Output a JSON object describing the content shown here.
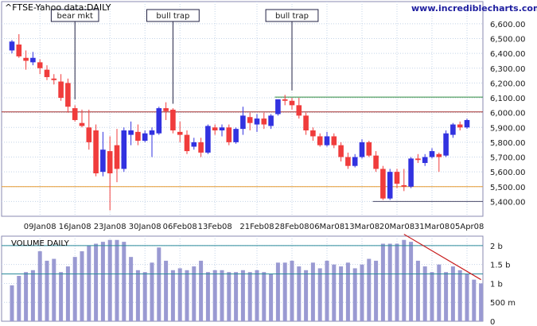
{
  "colors": {
    "up": "#3232e0",
    "down": "#f03c3c",
    "volume": "#9a9ad2",
    "grid": "#c4d4e8",
    "frame": "#8a8ab0",
    "resistance": "#2e8b3e",
    "support_red": "#a02828",
    "support_orange": "#e69a32",
    "support_dark": "#4a4a6a",
    "trend": "#c81e1e",
    "vol_line": "#2a8a9a",
    "text": "#1a1a1a"
  },
  "chart_data": [
    {
      "type": "candlestick",
      "title": "^FTSE-Yahoo data:DAILY",
      "site": "www.incrediblecharts.com",
      "ylim": [
        5300,
        6750
      ],
      "yticks": [
        5400,
        5500,
        5600,
        5700,
        5800,
        5900,
        6000,
        6100,
        6200,
        6300,
        6400,
        6500,
        6600
      ],
      "ytick_labels": [
        "5,400.00",
        "5,500.00",
        "5,600.00",
        "5,700.00",
        "5,800.00",
        "5,900.00",
        "6,000.00",
        "6,100.00",
        "6,200.00",
        "6,300.00",
        "6,400.00",
        "6,500.00",
        "6,600.00"
      ],
      "xtick_labels": [
        {
          "label": "09Jan08",
          "index": 4
        },
        {
          "label": "16Jan08",
          "index": 9
        },
        {
          "label": "23Jan08",
          "index": 14
        },
        {
          "label": "30Jan08",
          "index": 19
        },
        {
          "label": "06Feb08",
          "index": 24
        },
        {
          "label": "13Feb08",
          "index": 29
        },
        {
          "label": "21Feb08",
          "index": 35
        },
        {
          "label": "28Feb08",
          "index": 40
        },
        {
          "label": "06Mar08",
          "index": 45
        },
        {
          "label": "13Mar08",
          "index": 50
        },
        {
          "label": "20Mar08",
          "index": 55
        },
        {
          "label": "31Mar08",
          "index": 60
        },
        {
          "label": "05Apr08",
          "index": 65
        }
      ],
      "candles": [
        {
          "o": 6420,
          "h": 6490,
          "l": 6400,
          "c": 6480
        },
        {
          "o": 6460,
          "h": 6530,
          "l": 6370,
          "c": 6380
        },
        {
          "o": 6370,
          "h": 6420,
          "l": 6290,
          "c": 6350
        },
        {
          "o": 6340,
          "h": 6410,
          "l": 6320,
          "c": 6370
        },
        {
          "o": 6340,
          "h": 6360,
          "l": 6260,
          "c": 6300
        },
        {
          "o": 6290,
          "h": 6320,
          "l": 6220,
          "c": 6240
        },
        {
          "o": 6230,
          "h": 6260,
          "l": 6190,
          "c": 6220
        },
        {
          "o": 6210,
          "h": 6260,
          "l": 6080,
          "c": 6100
        },
        {
          "o": 6200,
          "h": 6230,
          "l": 6000,
          "c": 6040
        },
        {
          "o": 6030,
          "h": 6050,
          "l": 5940,
          "c": 5950
        },
        {
          "o": 5930,
          "h": 6020,
          "l": 5900,
          "c": 5910
        },
        {
          "o": 5900,
          "h": 6020,
          "l": 5750,
          "c": 5800
        },
        {
          "o": 5880,
          "h": 5920,
          "l": 5570,
          "c": 5590
        },
        {
          "o": 5600,
          "h": 5870,
          "l": 5570,
          "c": 5750
        },
        {
          "o": 5740,
          "h": 5840,
          "l": 5340,
          "c": 5590
        },
        {
          "o": 5780,
          "h": 5890,
          "l": 5530,
          "c": 5620
        },
        {
          "o": 5620,
          "h": 5900,
          "l": 5600,
          "c": 5880
        },
        {
          "o": 5850,
          "h": 5940,
          "l": 5780,
          "c": 5880
        },
        {
          "o": 5870,
          "h": 5920,
          "l": 5780,
          "c": 5810
        },
        {
          "o": 5810,
          "h": 5880,
          "l": 5800,
          "c": 5860
        },
        {
          "o": 5850,
          "h": 5900,
          "l": 5700,
          "c": 5880
        },
        {
          "o": 5860,
          "h": 6040,
          "l": 5850,
          "c": 6030
        },
        {
          "o": 6030,
          "h": 6070,
          "l": 5950,
          "c": 6010
        },
        {
          "o": 6020,
          "h": 6030,
          "l": 5860,
          "c": 5880
        },
        {
          "o": 5870,
          "h": 5940,
          "l": 5800,
          "c": 5850
        },
        {
          "o": 5850,
          "h": 5880,
          "l": 5720,
          "c": 5740
        },
        {
          "o": 5770,
          "h": 5830,
          "l": 5750,
          "c": 5800
        },
        {
          "o": 5800,
          "h": 5830,
          "l": 5700,
          "c": 5730
        },
        {
          "o": 5730,
          "h": 5920,
          "l": 5720,
          "c": 5910
        },
        {
          "o": 5900,
          "h": 5920,
          "l": 5850,
          "c": 5880
        },
        {
          "o": 5880,
          "h": 5920,
          "l": 5840,
          "c": 5900
        },
        {
          "o": 5900,
          "h": 5920,
          "l": 5780,
          "c": 5800
        },
        {
          "o": 5800,
          "h": 5900,
          "l": 5790,
          "c": 5890
        },
        {
          "o": 5890,
          "h": 6040,
          "l": 5850,
          "c": 5980
        },
        {
          "o": 5970,
          "h": 6000,
          "l": 5880,
          "c": 5930
        },
        {
          "o": 5920,
          "h": 5990,
          "l": 5870,
          "c": 5960
        },
        {
          "o": 5960,
          "h": 6000,
          "l": 5890,
          "c": 5920
        },
        {
          "o": 5910,
          "h": 5990,
          "l": 5890,
          "c": 5980
        },
        {
          "o": 5990,
          "h": 6060,
          "l": 5980,
          "c": 6090
        },
        {
          "o": 6090,
          "h": 6120,
          "l": 6050,
          "c": 6080
        },
        {
          "o": 6080,
          "h": 6100,
          "l": 6020,
          "c": 6050
        },
        {
          "o": 6050,
          "h": 6100,
          "l": 5960,
          "c": 5980
        },
        {
          "o": 5980,
          "h": 6000,
          "l": 5850,
          "c": 5880
        },
        {
          "o": 5880,
          "h": 5900,
          "l": 5810,
          "c": 5840
        },
        {
          "o": 5840,
          "h": 5860,
          "l": 5770,
          "c": 5780
        },
        {
          "o": 5780,
          "h": 5870,
          "l": 5770,
          "c": 5840
        },
        {
          "o": 5840,
          "h": 5860,
          "l": 5760,
          "c": 5780
        },
        {
          "o": 5780,
          "h": 5800,
          "l": 5670,
          "c": 5700
        },
        {
          "o": 5700,
          "h": 5730,
          "l": 5620,
          "c": 5640
        },
        {
          "o": 5640,
          "h": 5720,
          "l": 5630,
          "c": 5700
        },
        {
          "o": 5700,
          "h": 5820,
          "l": 5690,
          "c": 5800
        },
        {
          "o": 5800,
          "h": 5810,
          "l": 5700,
          "c": 5710
        },
        {
          "o": 5710,
          "h": 5740,
          "l": 5600,
          "c": 5620
        },
        {
          "o": 5620,
          "h": 5640,
          "l": 5410,
          "c": 5420
        },
        {
          "o": 5420,
          "h": 5620,
          "l": 5410,
          "c": 5600
        },
        {
          "o": 5600,
          "h": 5620,
          "l": 5490,
          "c": 5520
        },
        {
          "o": 5510,
          "h": 5620,
          "l": 5470,
          "c": 5500
        },
        {
          "o": 5500,
          "h": 5700,
          "l": 5490,
          "c": 5690
        },
        {
          "o": 5690,
          "h": 5720,
          "l": 5660,
          "c": 5680
        },
        {
          "o": 5660,
          "h": 5720,
          "l": 5640,
          "c": 5700
        },
        {
          "o": 5700,
          "h": 5760,
          "l": 5690,
          "c": 5740
        },
        {
          "o": 5720,
          "h": 5730,
          "l": 5600,
          "c": 5700
        },
        {
          "o": 5710,
          "h": 5880,
          "l": 5700,
          "c": 5860
        },
        {
          "o": 5850,
          "h": 5930,
          "l": 5830,
          "c": 5920
        },
        {
          "o": 5920,
          "h": 5940,
          "l": 5880,
          "c": 5900
        },
        {
          "o": 5900,
          "h": 5960,
          "l": 5890,
          "c": 5950
        }
      ],
      "levels": [
        {
          "value": 6105,
          "role": "resistance",
          "from_index": 38,
          "to_index": 68
        },
        {
          "value": 6005,
          "role": "support_red",
          "from_index": -1,
          "to_index": 68
        },
        {
          "value": 5500,
          "role": "support_orange",
          "from_index": -1,
          "to_index": 68
        },
        {
          "value": 5400,
          "role": "support_dark",
          "from_index": 52,
          "to_index": 68
        }
      ],
      "annotations": [
        {
          "label": "bear mkt",
          "index": 9,
          "value": 6090
        },
        {
          "label": "bull trap",
          "index": 23,
          "value": 6060
        },
        {
          "label": "bull trap",
          "index": 40,
          "value": 6150
        }
      ]
    },
    {
      "type": "bar",
      "title": "VOLUME DAILY",
      "ylim": [
        0,
        2.25
      ],
      "yticks": [
        0,
        0.5,
        1,
        1.5,
        2
      ],
      "ytick_labels": [
        "0",
        "500 m",
        "1 b",
        "1.5 b",
        "2 b"
      ],
      "values": [
        0.95,
        1.2,
        1.3,
        1.35,
        1.85,
        1.6,
        1.65,
        1.3,
        1.45,
        1.7,
        1.85,
        2.0,
        2.05,
        2.1,
        2.15,
        2.15,
        2.1,
        1.7,
        1.35,
        1.3,
        1.55,
        1.95,
        1.6,
        1.35,
        1.4,
        1.35,
        1.45,
        1.6,
        1.3,
        1.35,
        1.35,
        1.3,
        1.3,
        1.35,
        1.3,
        1.35,
        1.3,
        1.25,
        1.55,
        1.55,
        1.6,
        1.45,
        1.35,
        1.55,
        1.4,
        1.6,
        1.5,
        1.45,
        1.55,
        1.4,
        1.5,
        1.65,
        1.6,
        2.05,
        2.05,
        2.05,
        2.15,
        2.1,
        1.6,
        1.45,
        1.3,
        1.5,
        1.3,
        1.45,
        1.35,
        1.25,
        1.1,
        1.0
      ],
      "levels": [
        2.0,
        1.25
      ],
      "trend": {
        "from_index": 56,
        "from_value": 2.3,
        "to_index": 67,
        "to_value": 1.1
      }
    }
  ]
}
